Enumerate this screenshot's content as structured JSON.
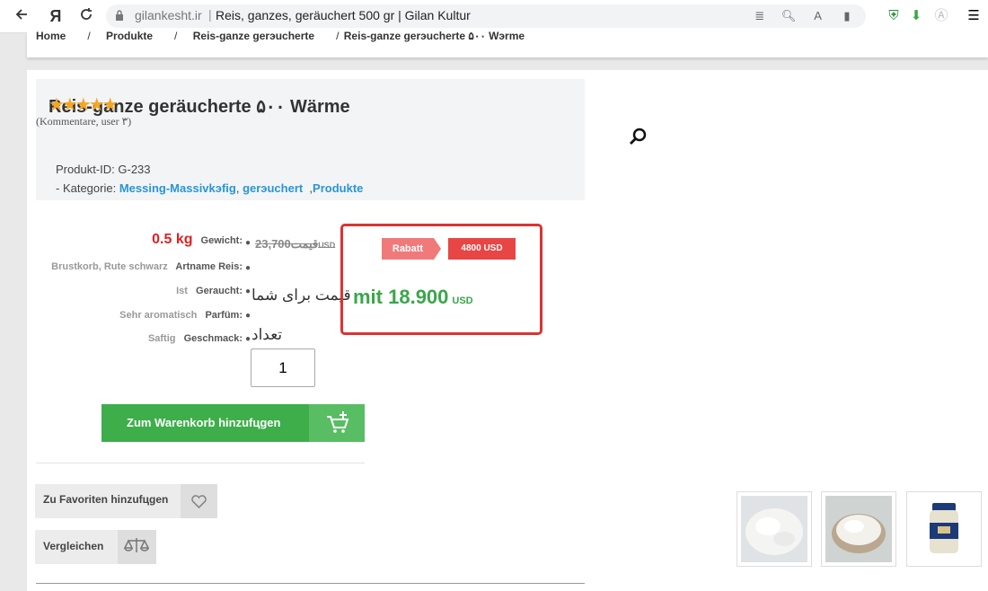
{
  "browser": {
    "back_icon": "back-arrow-icon",
    "yandex_logo": "Я",
    "domain": "gilankesht.ir",
    "tab_title": "Reis, ganzes, geräuchert 500 gr | Gilan Kultur",
    "sep": "|"
  },
  "breadcrumb": [
    "Home",
    "Produkte",
    "Reis-ganze gerэucherte",
    "Reis-ganze gerэucherte ۵۰۰ Wэrme"
  ],
  "product": {
    "title": "Reis-ganze geräucherte ۵۰۰ Wärme",
    "reviews": "(Kommentare, user ۳)",
    "id_label": "Produkt-ID:",
    "id_value": "G-233",
    "category_label": "- Kategorie:",
    "categories": [
      "Messing-Massivkэfig",
      "gerэuchert",
      "Produkte"
    ],
    "rating_stars": 5
  },
  "attributes": [
    {
      "value": "0.5 kg",
      "label": "Gewicht:"
    },
    {
      "value": "Brustkorb, Rute schwarz",
      "label": "Artname Reis:"
    },
    {
      "value": "Ist",
      "label": "Geraucht:"
    },
    {
      "value": "Sehr aromatisch",
      "label": "Parfüm:"
    },
    {
      "value": "Saftig",
      "label": "Geschmack:"
    }
  ],
  "pricing": {
    "old_price": "23,700",
    "old_label": "قیمت",
    "old_currency": "USD",
    "rabatt": "Rabatt",
    "discount": "4800 USD",
    "price_label": "قیمت برای شما",
    "new_price": "mit 18.900",
    "currency": "USD"
  },
  "quantity": {
    "label": "تعداد",
    "value": "1"
  },
  "buttons": {
    "add_to_cart": "Zum Warenkorb hinzufцgen",
    "favorites": "Zu Favoriten hinzufцgen",
    "compare": "Vergleichen"
  },
  "colors": {
    "accent_green": "#3dae4a",
    "price_red": "#e02020",
    "link_blue": "#2a95d4",
    "highlight_red": "#d93434"
  }
}
